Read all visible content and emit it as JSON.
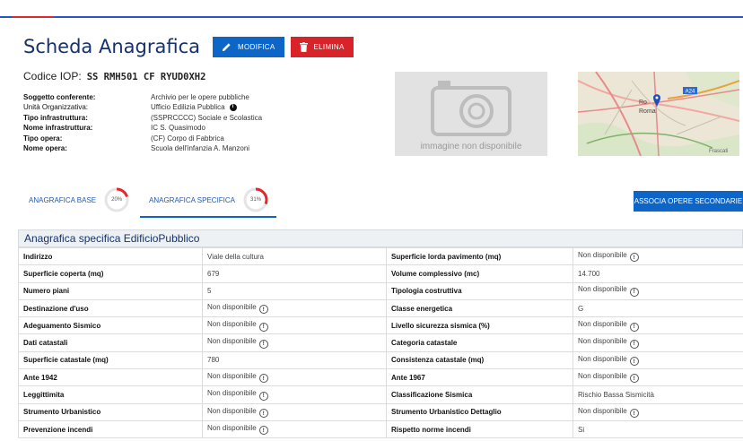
{
  "header": {
    "title": "Scheda Anagrafica",
    "edit_label": "MODIFICA",
    "delete_label": "ELIMINA"
  },
  "codice": {
    "label": "Codice IOP:",
    "value": "SS RMH501 CF RYUD0XH2"
  },
  "info": [
    {
      "label": "Soggetto conferente:",
      "value": "Archivio per le opere pubbliche"
    },
    {
      "label": "Unità Organizzativa:",
      "value": "Ufficio Edilizia Pubblica"
    },
    {
      "label": "Tipo infrastruttura:",
      "value": "(SSPRCCCC) Sociale e Scolastica"
    },
    {
      "label": "Nome infrastruttura:",
      "value": "IC S. Quasimodo"
    },
    {
      "label": "Tipo opera:",
      "value": "(CF) Corpo di Fabbrica"
    },
    {
      "label": "Nome opera:",
      "value": "Scuola dell'infanzia A. Manzoni"
    }
  ],
  "image": {
    "no_image_label": "immagine non disponibile"
  },
  "map": {
    "road_badge": "A24",
    "city_label_1": "Ro",
    "city_label_2": "Roma",
    "place_label": "Frascati"
  },
  "tabs": [
    {
      "label": "ANAGRAFICA BASE",
      "percent_label": "20%",
      "percent": 20
    },
    {
      "label": "ANAGRAFICA SPECIFICA",
      "percent_label": "31%",
      "percent": 31,
      "active": true
    }
  ],
  "assoc_button": "ASSOCIA OPERE SECONDARIE",
  "spec": {
    "title": "Anagrafica specifica EdificioPubblico",
    "rows": [
      [
        "Indirizzo",
        "Viale della cultura",
        "Superficie lorda pavimento (mq)",
        "Non disponibile"
      ],
      [
        "Superficie coperta (mq)",
        "679",
        "Volume complessivo (mc)",
        "14.700"
      ],
      [
        "Numero piani",
        "5",
        "Tipologia costruttiva",
        "Non disponibile"
      ],
      [
        "Destinazione d'uso",
        "Non disponibile",
        "Classe energetica",
        "G"
      ],
      [
        "Adeguamento Sismico",
        "Non disponibile",
        "Livello sicurezza sismica (%)",
        "Non disponibile"
      ],
      [
        "Dati catastali",
        "Non disponibile",
        "Categoria catastale",
        "Non disponibile"
      ],
      [
        "Superficie catastale (mq)",
        "780",
        "Consistenza catastale (mq)",
        "Non disponibile"
      ],
      [
        "Ante 1942",
        "Non disponibile",
        "Ante 1967",
        "Non disponibile"
      ],
      [
        "Leggittimita",
        "Non disponibile",
        "Classificazione Sismica",
        "Rischio Bassa Sismicità"
      ],
      [
        "Strumento Urbanistico",
        "Non disponibile",
        "Strumento Urbanistico Dettaglio",
        "Non disponibile"
      ],
      [
        "Prevenzione incendi",
        "Non disponibile",
        "Rispetto norme incendi",
        "Si"
      ]
    ]
  },
  "colors": {
    "primary": "#0d65c8",
    "danger": "#d8232a",
    "title": "#17316b",
    "gauge_arc": "#e0282e"
  }
}
